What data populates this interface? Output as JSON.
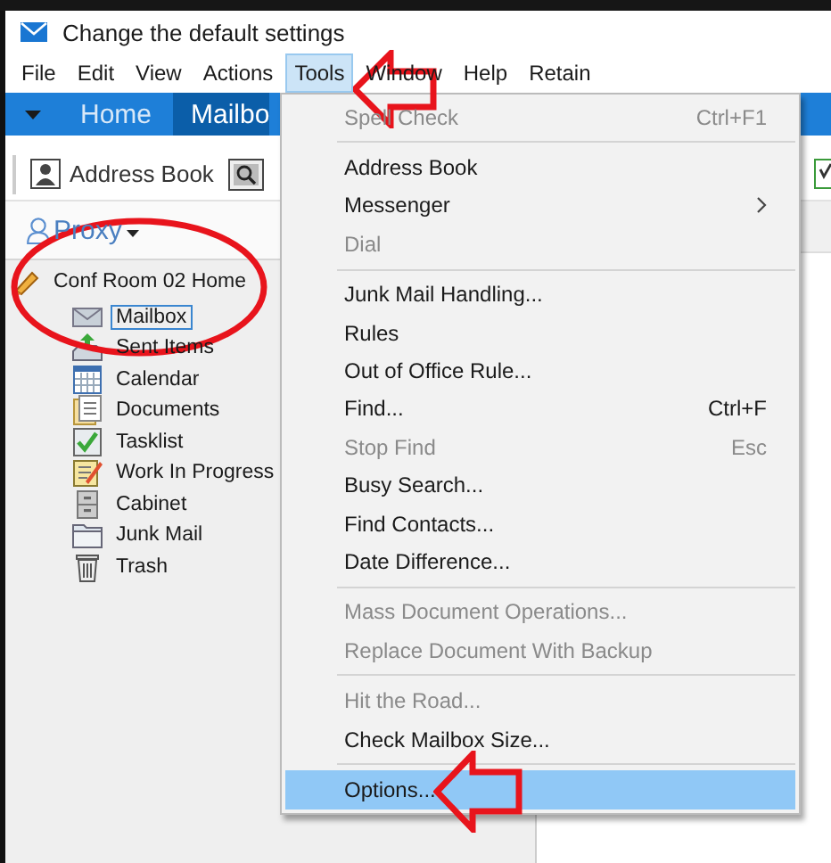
{
  "window": {
    "title": "Change the default settings"
  },
  "menu_bar": [
    {
      "label": "File",
      "selected": false
    },
    {
      "label": "Edit",
      "selected": false
    },
    {
      "label": "View",
      "selected": false
    },
    {
      "label": "Actions",
      "selected": false
    },
    {
      "label": "Tools",
      "selected": true
    },
    {
      "label": "Window",
      "selected": false
    },
    {
      "label": "Help",
      "selected": false
    },
    {
      "label": "Retain",
      "selected": false
    }
  ],
  "ribbon_tabs": [
    {
      "label": "Home",
      "selected": false
    },
    {
      "label": "Mailbo",
      "selected": true
    }
  ],
  "toolbar": {
    "address_book": "Address Book"
  },
  "proxy": "Proxy",
  "tree": {
    "label": "Conf Room 02 Home",
    "children": [
      {
        "label": "Mailbox",
        "selected": true
      },
      {
        "label": "Sent Items",
        "selected": false
      },
      {
        "label": "Calendar",
        "selected": false
      },
      {
        "label": "Documents",
        "selected": false
      },
      {
        "label": "Tasklist",
        "selected": false
      },
      {
        "label": "Work In Progress",
        "selected": false
      },
      {
        "label": "Cabinet",
        "selected": false
      },
      {
        "label": "Junk Mail",
        "selected": false
      },
      {
        "label": "Trash",
        "selected": false
      }
    ]
  },
  "tools_menu": [
    {
      "kind": "item",
      "label": "Spell Check",
      "shortcut": "Ctrl+F1",
      "disabled": true,
      "selected": false
    },
    {
      "kind": "separator"
    },
    {
      "kind": "item",
      "label": "Address Book",
      "disabled": false,
      "selected": false
    },
    {
      "kind": "submenu",
      "label": "Messenger",
      "disabled": false,
      "selected": false
    },
    {
      "kind": "item",
      "label": "Dial",
      "disabled": true,
      "selected": false
    },
    {
      "kind": "separator"
    },
    {
      "kind": "item",
      "label": "Junk Mail Handling...",
      "disabled": false,
      "selected": false
    },
    {
      "kind": "item",
      "label": "Rules",
      "disabled": false,
      "selected": false
    },
    {
      "kind": "item",
      "label": "Out of Office Rule...",
      "disabled": false,
      "selected": false
    },
    {
      "kind": "item",
      "label": "Find...",
      "shortcut": "Ctrl+F",
      "disabled": false,
      "selected": false
    },
    {
      "kind": "item",
      "label": "Stop Find",
      "shortcut": "Esc",
      "disabled": true,
      "selected": false
    },
    {
      "kind": "item",
      "label": "Busy Search...",
      "disabled": false,
      "selected": false
    },
    {
      "kind": "item",
      "label": "Find Contacts...",
      "disabled": false,
      "selected": false
    },
    {
      "kind": "item",
      "label": "Date Difference...",
      "disabled": false,
      "selected": false
    },
    {
      "kind": "separator"
    },
    {
      "kind": "item",
      "label": "Mass Document Operations...",
      "disabled": true,
      "selected": false
    },
    {
      "kind": "item",
      "label": "Replace Document With Backup",
      "disabled": true,
      "selected": false
    },
    {
      "kind": "separator"
    },
    {
      "kind": "item",
      "label": "Hit the Road...",
      "disabled": true,
      "selected": false
    },
    {
      "kind": "item",
      "label": "Check Mailbox Size...",
      "disabled": false,
      "selected": false
    },
    {
      "kind": "separator"
    },
    {
      "kind": "item",
      "label": "Options...",
      "disabled": false,
      "selected": true
    }
  ]
}
